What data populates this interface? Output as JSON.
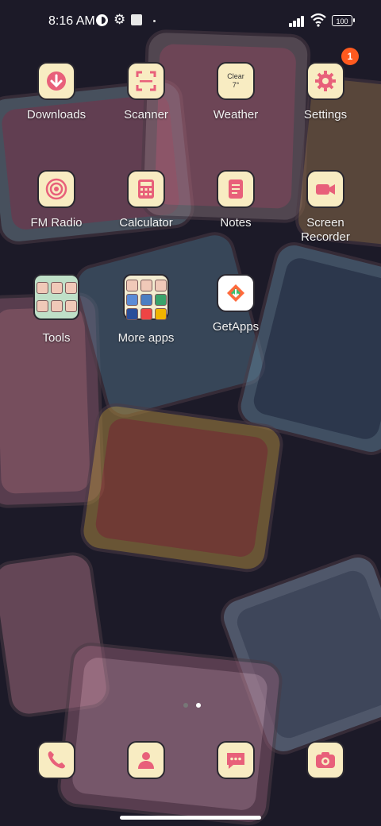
{
  "status_bar": {
    "time": "8:16 AM",
    "battery": "100",
    "icons": [
      "dnd-icon",
      "gear-icon",
      "screenshot-icon",
      "dot-icon",
      "signal-icon",
      "wifi-icon",
      "battery-icon"
    ]
  },
  "apps": [
    {
      "label": "Downloads",
      "icon": "download-arrow-icon"
    },
    {
      "label": "Scanner",
      "icon": "scanner-icon"
    },
    {
      "label": "Weather",
      "icon": "weather-icon",
      "tile_text_top": "Clear",
      "tile_text_bottom": "7°"
    },
    {
      "label": "Settings",
      "icon": "gear-icon",
      "badge": "1"
    },
    {
      "label": "FM Radio",
      "icon": "radio-icon"
    },
    {
      "label": "Calculator",
      "icon": "calculator-icon"
    },
    {
      "label": "Notes",
      "icon": "notes-icon"
    },
    {
      "label": "Screen\nRecorder",
      "icon": "video-camera-icon"
    },
    {
      "label": "Tools",
      "icon": "folder-icon"
    },
    {
      "label": "More apps",
      "icon": "folder-icon"
    },
    {
      "label": "GetApps",
      "icon": "getapps-icon"
    }
  ],
  "page_indicator": {
    "pages": 2,
    "active": 2
  },
  "dock": [
    {
      "icon": "phone-icon"
    },
    {
      "icon": "contacts-icon"
    },
    {
      "icon": "messages-icon"
    },
    {
      "icon": "camera-icon"
    }
  ],
  "colors": {
    "tile": "#f8ecc2",
    "icon_accent": "#e8607a",
    "badge": "#ff5a1f",
    "background": "#1c1a28"
  }
}
